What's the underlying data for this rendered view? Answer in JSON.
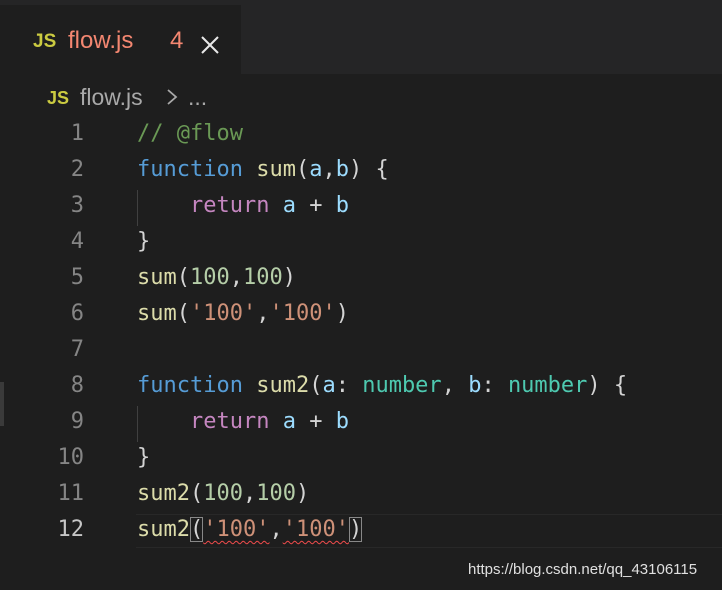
{
  "tab": {
    "icon": "JS",
    "title": "flow.js",
    "problem_count": "4",
    "close_icon": "close-icon"
  },
  "breadcrumb": {
    "icon": "JS",
    "file": "flow.js",
    "separator_icon": "chevron-right-icon",
    "ellipsis": "..."
  },
  "editor": {
    "active_line": "12",
    "lines": [
      {
        "number": "1",
        "tokens": [
          {
            "t": "// @flow",
            "c": "comment"
          }
        ]
      },
      {
        "number": "2",
        "tokens": [
          {
            "t": "function",
            "c": "kw"
          },
          {
            "t": " ",
            "c": "punc"
          },
          {
            "t": "sum",
            "c": "fn"
          },
          {
            "t": "(",
            "c": "punc"
          },
          {
            "t": "a",
            "c": "param"
          },
          {
            "t": ",",
            "c": "punc"
          },
          {
            "t": "b",
            "c": "param"
          },
          {
            "t": ") {",
            "c": "punc"
          }
        ]
      },
      {
        "number": "3",
        "tokens": [
          {
            "t": "    ",
            "c": "punc"
          },
          {
            "t": "return",
            "c": "ctrl"
          },
          {
            "t": " ",
            "c": "punc"
          },
          {
            "t": "a",
            "c": "param"
          },
          {
            "t": " + ",
            "c": "punc"
          },
          {
            "t": "b",
            "c": "param"
          }
        ],
        "guide": true
      },
      {
        "number": "4",
        "tokens": [
          {
            "t": "}",
            "c": "punc"
          }
        ]
      },
      {
        "number": "5",
        "tokens": [
          {
            "t": "sum",
            "c": "fn"
          },
          {
            "t": "(",
            "c": "punc"
          },
          {
            "t": "100",
            "c": "num"
          },
          {
            "t": ",",
            "c": "punc"
          },
          {
            "t": "100",
            "c": "num"
          },
          {
            "t": ")",
            "c": "punc"
          }
        ]
      },
      {
        "number": "6",
        "tokens": [
          {
            "t": "sum",
            "c": "fn"
          },
          {
            "t": "(",
            "c": "punc"
          },
          {
            "t": "'100'",
            "c": "str"
          },
          {
            "t": ",",
            "c": "punc"
          },
          {
            "t": "'100'",
            "c": "str"
          },
          {
            "t": ")",
            "c": "punc"
          }
        ]
      },
      {
        "number": "7",
        "tokens": []
      },
      {
        "number": "8",
        "tokens": [
          {
            "t": "function",
            "c": "kw"
          },
          {
            "t": " ",
            "c": "punc"
          },
          {
            "t": "sum2",
            "c": "fn"
          },
          {
            "t": "(",
            "c": "punc"
          },
          {
            "t": "a",
            "c": "param"
          },
          {
            "t": ": ",
            "c": "punc"
          },
          {
            "t": "number",
            "c": "type"
          },
          {
            "t": ", ",
            "c": "punc"
          },
          {
            "t": "b",
            "c": "param"
          },
          {
            "t": ": ",
            "c": "punc"
          },
          {
            "t": "number",
            "c": "type"
          },
          {
            "t": ") {",
            "c": "punc"
          }
        ]
      },
      {
        "number": "9",
        "tokens": [
          {
            "t": "    ",
            "c": "punc"
          },
          {
            "t": "return",
            "c": "ctrl"
          },
          {
            "t": " ",
            "c": "punc"
          },
          {
            "t": "a",
            "c": "param"
          },
          {
            "t": " + ",
            "c": "punc"
          },
          {
            "t": "b",
            "c": "param"
          }
        ],
        "guide": true
      },
      {
        "number": "10",
        "tokens": [
          {
            "t": "}",
            "c": "punc"
          }
        ]
      },
      {
        "number": "11",
        "tokens": [
          {
            "t": "sum2",
            "c": "fn"
          },
          {
            "t": "(",
            "c": "punc"
          },
          {
            "t": "100",
            "c": "num"
          },
          {
            "t": ",",
            "c": "punc"
          },
          {
            "t": "100",
            "c": "num"
          },
          {
            "t": ")",
            "c": "punc"
          }
        ]
      },
      {
        "number": "12",
        "tokens": [
          {
            "t": "sum2",
            "c": "fn"
          },
          {
            "t": "(",
            "c": "punc",
            "m": 1
          },
          {
            "t": "'100'",
            "c": "str",
            "e": 1
          },
          {
            "t": ",",
            "c": "punc"
          },
          {
            "t": "'100'",
            "c": "str",
            "e": 1
          },
          {
            "t": ")",
            "c": "punc",
            "m": 1
          }
        ]
      }
    ]
  },
  "watermark": "https://blog.csdn.net/qq_43106115",
  "colors": {
    "background": "#1e1e1e",
    "tab_error_text": "#f48771",
    "js_icon": "#cbcb41",
    "error_squiggle": "#f14c4c"
  }
}
